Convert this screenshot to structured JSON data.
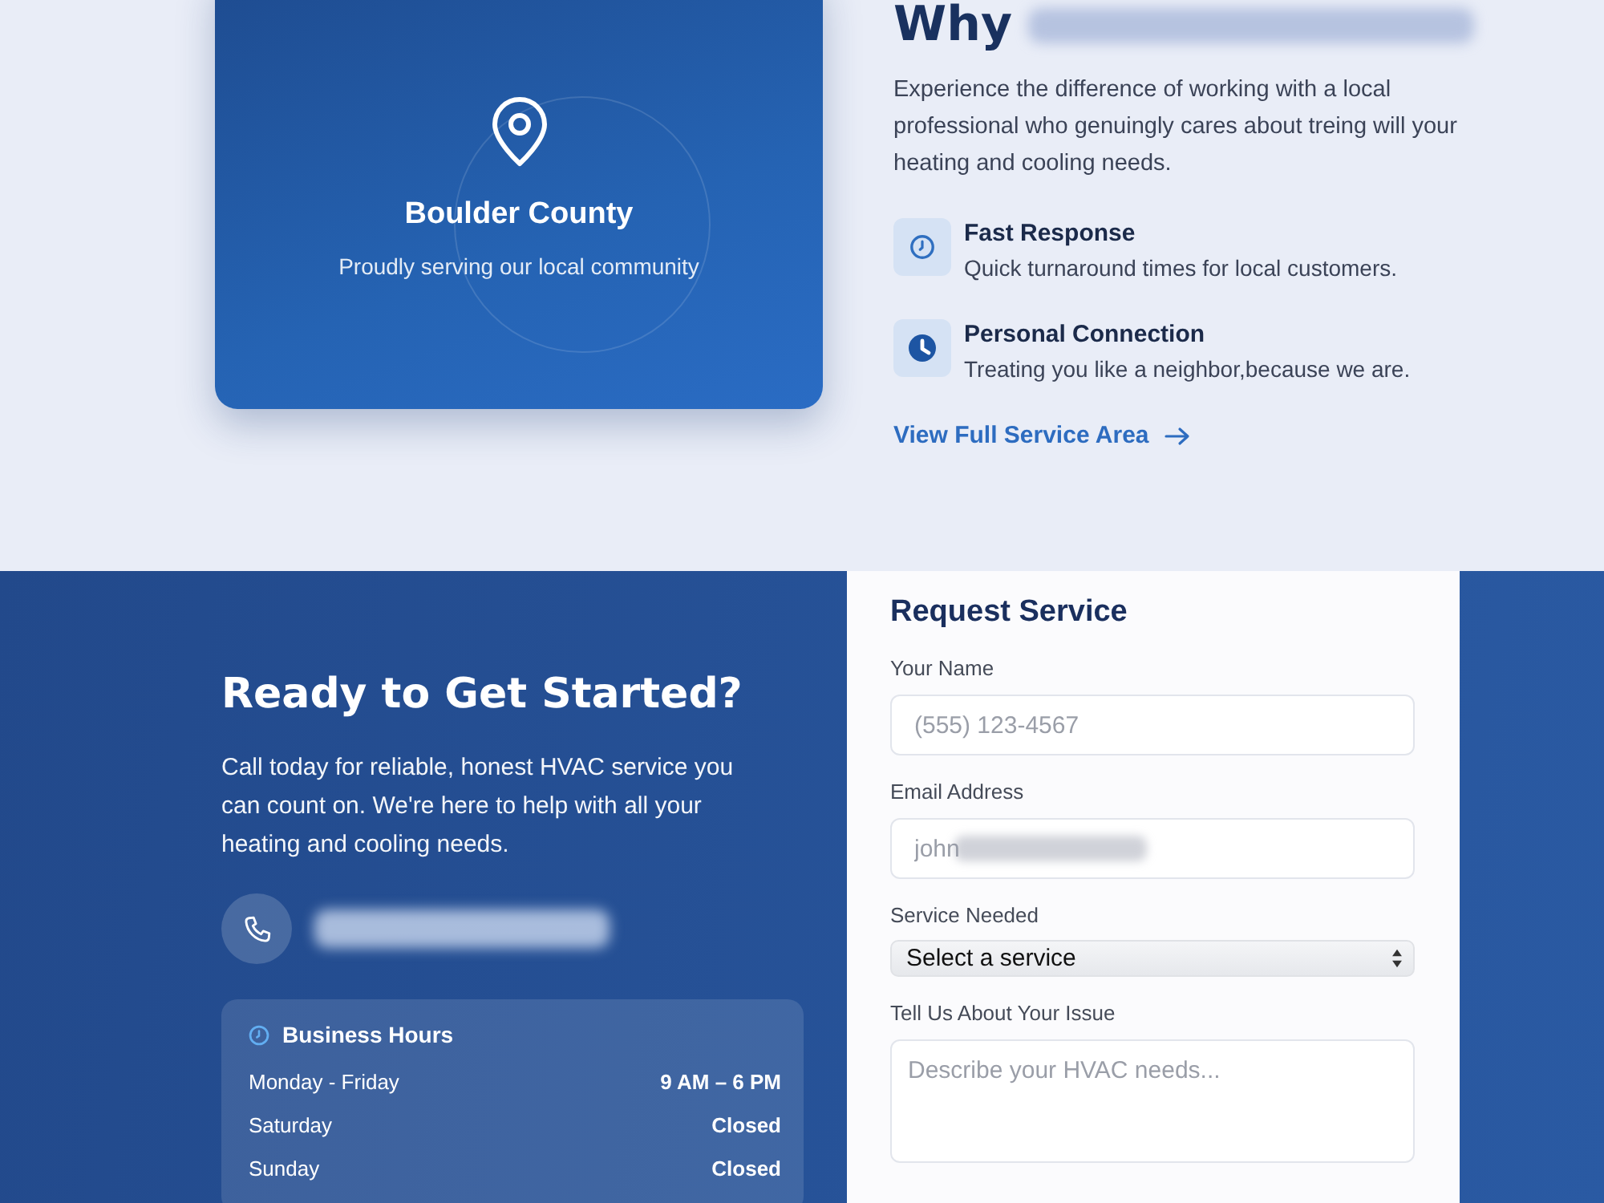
{
  "service_area_card": {
    "title": "Boulder County",
    "subtitle": "Proudly serving our local community"
  },
  "why_section": {
    "heading": "Why",
    "intro": "Experience the difference of working with a local professional who genuingly cares about treing will your heating and cooling needs.",
    "features": [
      {
        "kind": "clock",
        "title": "Fast Response",
        "description": "Quick turnaround times for local customers."
      },
      {
        "kind": "filled-clock",
        "title": "Personal Connection",
        "description": "Treating you like a neighbor,because we are."
      }
    ],
    "link": "View Full Service Area"
  },
  "contact_section": {
    "heading": "Ready to Get Started?",
    "intro": "Call today for reliable, honest HVAC service you can count on. We're here to help with all your heating and cooling needs.",
    "business_hours": {
      "title": "Business Hours",
      "rows": [
        {
          "days": "Monday - Friday",
          "hours": "9 AM – 6 PM"
        },
        {
          "days": "Saturday",
          "hours": "Closed"
        },
        {
          "days": "Sunday",
          "hours": "Closed"
        }
      ]
    }
  },
  "request_form": {
    "title": "Request Service",
    "fields": [
      {
        "kind": "text",
        "label": "Your Name",
        "placeholder": "(555) 123-4567"
      },
      {
        "kind": "email",
        "label": "Email Address",
        "placeholder": "john"
      },
      {
        "kind": "select",
        "label": "Service Needed",
        "value": "Select a service"
      },
      {
        "kind": "textarea",
        "label": "Tell Us About Your Issue",
        "placeholder": "Describe your HVAC needs..."
      }
    ]
  }
}
